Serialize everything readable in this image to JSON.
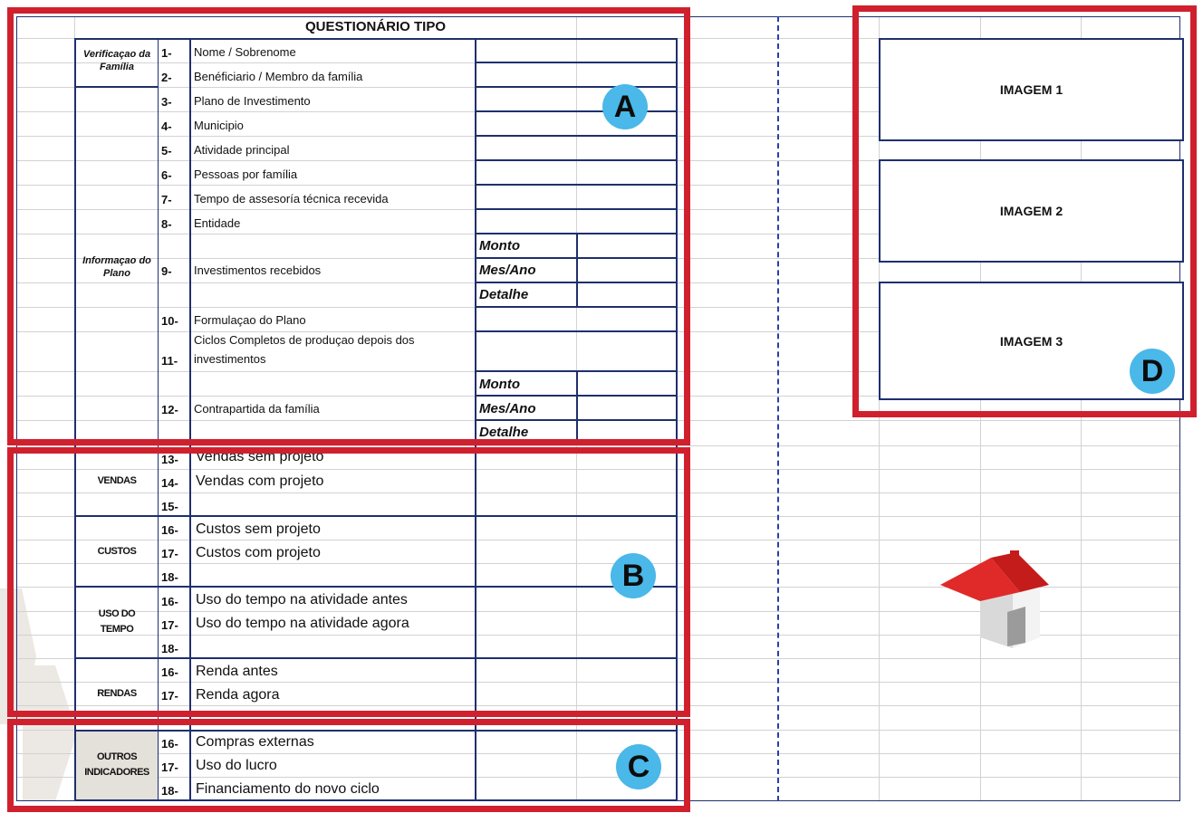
{
  "title": "QUESTIONÁRIO TIPO",
  "sections": {
    "verificacao": "Verificaçao da Família",
    "informacao": "Informaçao do Plano"
  },
  "rows": [
    {
      "num": "1-",
      "label": "Nome / Sobrenome"
    },
    {
      "num": "2-",
      "label": "Benéficiario / Membro da família"
    },
    {
      "num": "3-",
      "label": "Plano de Investimento"
    },
    {
      "num": "4-",
      "label": "Municipio"
    },
    {
      "num": "5-",
      "label": "Atividade principal"
    },
    {
      "num": "6-",
      "label": "Pessoas por família"
    },
    {
      "num": "7-",
      "label": "Tempo de assesoría técnica recevida"
    },
    {
      "num": "8-",
      "label": "Entidade"
    },
    {
      "num": "9-",
      "label": "Investimentos recebidos"
    },
    {
      "num": "10-",
      "label": "Formulaçao do Plano"
    },
    {
      "num": "11-",
      "label": "investimentos"
    },
    {
      "num": "12-",
      "label": "Contrapartida da família"
    }
  ],
  "row11_line1": "Ciclos Completos de produçao depois dos",
  "subfields_9": [
    "Monto",
    "Mes/Ano",
    "Detalhe"
  ],
  "subfields_12": [
    "Monto",
    "Mes/Ano",
    "Detalhe"
  ],
  "groups": [
    {
      "name": "VENDAS",
      "rows": [
        {
          "num": "13-",
          "label": "Vendas sem projeto"
        },
        {
          "num": "14-",
          "label": "Vendas com projeto"
        },
        {
          "num": "15-",
          "label": ""
        }
      ]
    },
    {
      "name": "CUSTOS",
      "rows": [
        {
          "num": "16-",
          "label": "Custos sem projeto"
        },
        {
          "num": "17-",
          "label": "Custos com projeto"
        },
        {
          "num": "18-",
          "label": ""
        }
      ]
    },
    {
      "name": "USO DO TEMPO",
      "rows": [
        {
          "num": "16-",
          "label": "Uso do tempo na atividade antes"
        },
        {
          "num": "17-",
          "label": "Uso do tempo na atividade agora"
        },
        {
          "num": "18-",
          "label": ""
        }
      ]
    },
    {
      "name": "RENDAS",
      "rows": [
        {
          "num": "16-",
          "label": "Renda antes"
        },
        {
          "num": "17-",
          "label": "Renda agora"
        }
      ]
    },
    {
      "name": "OUTROS INDICADORES",
      "rows": [
        {
          "num": "16-",
          "label": "Compras externas"
        },
        {
          "num": "17-",
          "label": "Uso do lucro"
        },
        {
          "num": "18-",
          "label": "Financiamento do novo ciclo"
        }
      ]
    }
  ],
  "images": [
    "IMAGEM 1",
    "IMAGEM 2",
    "IMAGEM 3"
  ],
  "badges": {
    "a": "A",
    "b": "B",
    "c": "C",
    "d": "D"
  },
  "colors": {
    "highlight": "#d0202e",
    "badge": "#4ab8e8",
    "table_border": "#1f2f6e",
    "gridline": "#d2d2d2",
    "house_roof": "#e02a2a"
  }
}
